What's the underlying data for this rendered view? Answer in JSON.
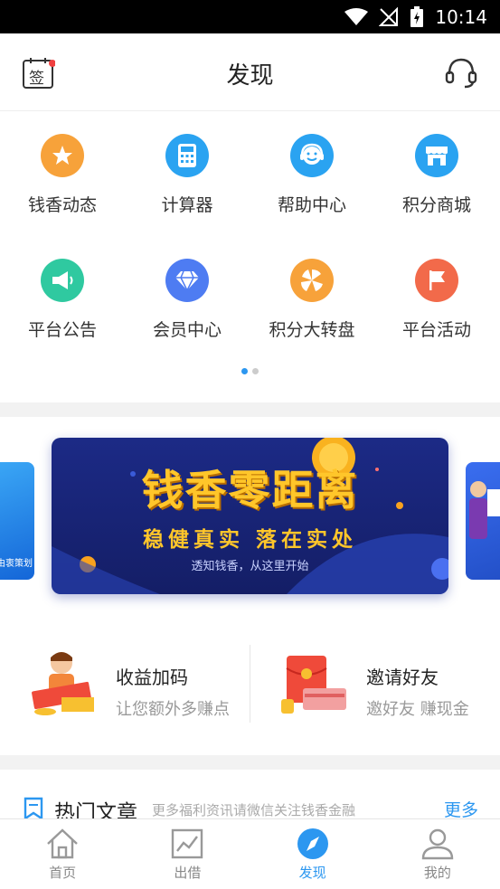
{
  "status_bar": {
    "time": "10:14"
  },
  "header": {
    "title": "发现",
    "sign_label": "签"
  },
  "grid": {
    "items": [
      {
        "label": "钱香动态",
        "icon": "star-icon",
        "color": "#f7a23a"
      },
      {
        "label": "计算器",
        "icon": "calculator-icon",
        "color": "#2aa3f1"
      },
      {
        "label": "帮助中心",
        "icon": "headset-icon",
        "color": "#2aa3f1"
      },
      {
        "label": "积分商城",
        "icon": "shop-icon",
        "color": "#2aa3f1"
      },
      {
        "label": "平台公告",
        "icon": "megaphone-icon",
        "color": "#2fc9a0"
      },
      {
        "label": "会员中心",
        "icon": "diamond-icon",
        "color": "#4e7cf2"
      },
      {
        "label": "积分大转盘",
        "icon": "wheel-icon",
        "color": "#f7a23a"
      },
      {
        "label": "平台活动",
        "icon": "flag-icon",
        "color": "#f26a4a"
      }
    ],
    "page_index": 1,
    "page_count": 2
  },
  "banner": {
    "headline": "钱香零距离",
    "tagline": "稳健真实  落在实处",
    "subtitle": "透知钱香，从这里开始",
    "left_peek_text": "由衷策划"
  },
  "promos": [
    {
      "title": "收益加码",
      "subtitle": "让您额外多赚点",
      "icon": "bonus-illustration-icon"
    },
    {
      "title": "邀请好友",
      "subtitle": "邀好友 赚现金",
      "icon": "red-envelope-icon"
    }
  ],
  "articles": {
    "title": "热门文章",
    "subtitle": "更多福利资讯请微信关注钱香金融",
    "more_label": "更多"
  },
  "tabbar": {
    "tabs": [
      {
        "label": "首页",
        "icon": "home-icon",
        "active": false
      },
      {
        "label": "出借",
        "icon": "chart-icon",
        "active": false
      },
      {
        "label": "发现",
        "icon": "compass-icon",
        "active": true
      },
      {
        "label": "我的",
        "icon": "user-icon",
        "active": false
      }
    ]
  },
  "colors": {
    "accent": "#2c97f0",
    "banner_gold": "#ffc62a",
    "banner_bg": "#1c2a86"
  }
}
